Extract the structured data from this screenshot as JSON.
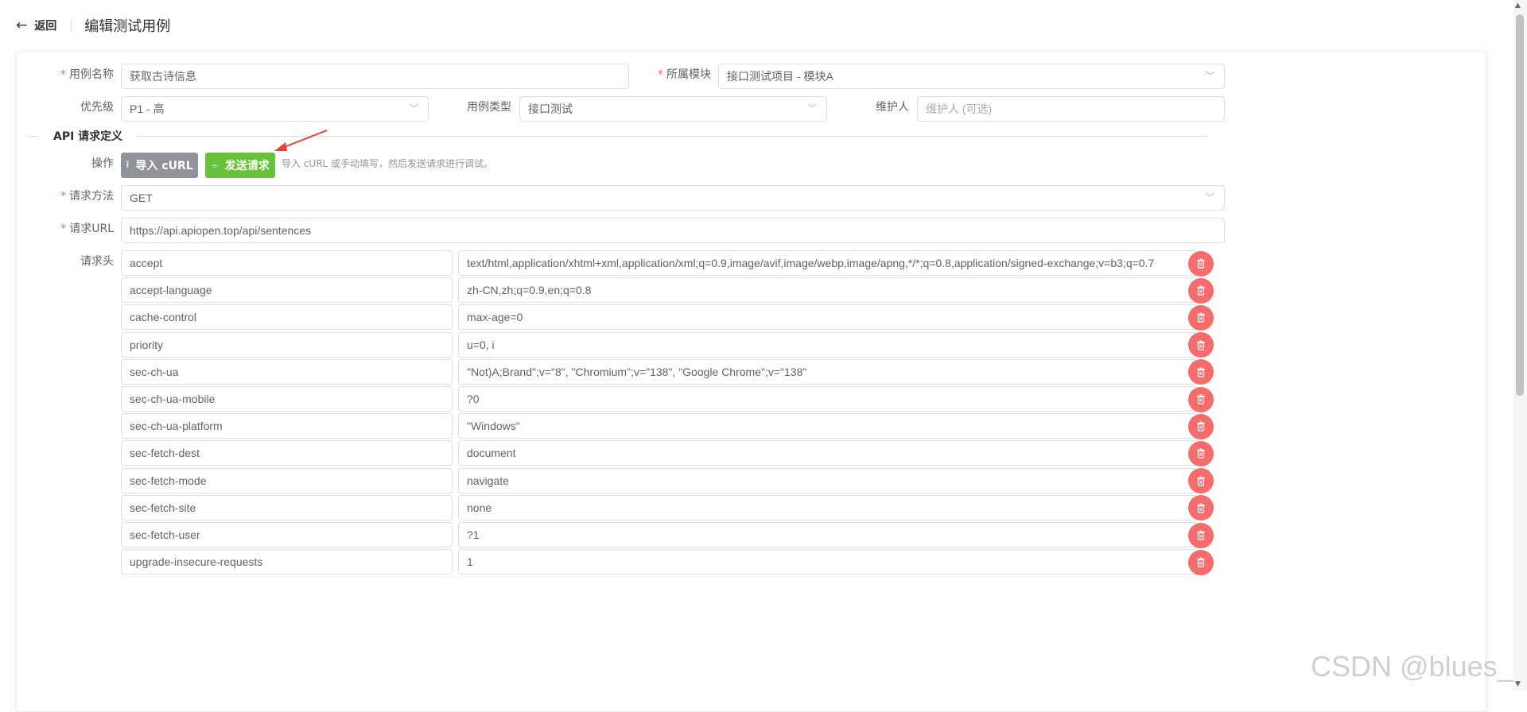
{
  "header": {
    "back_label": "返回",
    "title": "编辑测试用例"
  },
  "form": {
    "case_name": {
      "label": "用例名称",
      "value": "获取古诗信息"
    },
    "module": {
      "label": "所属模块",
      "value": "接口测试项目 - 模块A"
    },
    "priority": {
      "label": "优先级",
      "value": "P1 - 高"
    },
    "case_type": {
      "label": "用例类型",
      "value": "接口测试"
    },
    "maintainer": {
      "label": "维护人",
      "placeholder": "维护人 (可选)"
    }
  },
  "api_section": {
    "title": "API 请求定义",
    "ops_label": "操作",
    "import_label": "导入 cURL",
    "send_label": "发送请求",
    "hint": "导入 cURL 或手动填写，然后发送请求进行调试。",
    "method": {
      "label": "请求方法",
      "value": "GET"
    },
    "url": {
      "label": "请求URL",
      "value": "https://api.apiopen.top/api/sentences"
    },
    "headers_label": "请求头",
    "headers": [
      {
        "key": "accept",
        "value": "text/html,application/xhtml+xml,application/xml;q=0.9,image/avif,image/webp,image/apng,*/*;q=0.8,application/signed-exchange;v=b3;q=0.7"
      },
      {
        "key": "accept-language",
        "value": "zh-CN,zh;q=0.9,en;q=0.8"
      },
      {
        "key": "cache-control",
        "value": "max-age=0"
      },
      {
        "key": "priority",
        "value": "u=0, i"
      },
      {
        "key": "sec-ch-ua",
        "value": "\"Not)A;Brand\";v=\"8\", \"Chromium\";v=\"138\", \"Google Chrome\";v=\"138\""
      },
      {
        "key": "sec-ch-ua-mobile",
        "value": "?0"
      },
      {
        "key": "sec-ch-ua-platform",
        "value": "\"Windows\""
      },
      {
        "key": "sec-fetch-dest",
        "value": "document"
      },
      {
        "key": "sec-fetch-mode",
        "value": "navigate"
      },
      {
        "key": "sec-fetch-site",
        "value": "none"
      },
      {
        "key": "sec-fetch-user",
        "value": "?1"
      },
      {
        "key": "upgrade-insecure-requests",
        "value": "1"
      }
    ]
  },
  "watermark": "CSDN @blues_C",
  "colors": {
    "accent_green": "#67c23a",
    "danger_red": "#f56c6c",
    "gray_button": "#909399",
    "arrow_red": "#e8403a"
  }
}
